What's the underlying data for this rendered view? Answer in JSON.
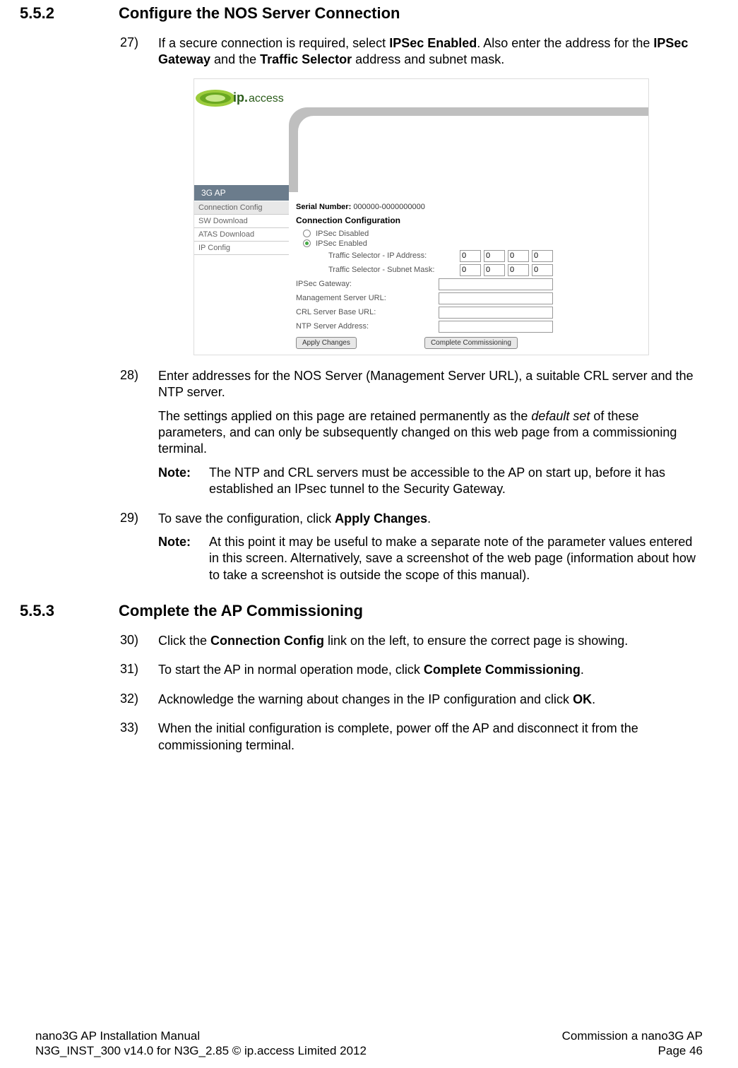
{
  "sections": {
    "s552": {
      "num": "5.5.2",
      "title": "Configure the NOS Server Connection"
    },
    "s553": {
      "num": "5.5.3",
      "title": "Complete the AP Commissioning"
    }
  },
  "steps": {
    "n27": "27)",
    "t27_a": "If a secure connection is required, select ",
    "t27_b": "IPSec Enabled",
    "t27_c": ". Also enter the address for the ",
    "t27_d": "IPSec Gateway",
    "t27_e": " and the ",
    "t27_f": "Traffic Selector",
    "t27_g": " address and subnet mask.",
    "n28": "28)",
    "t28": "Enter addresses for the NOS Server (Management Server URL), a suitable CRL server and the NTP server.",
    "p28a_a": "The settings applied on this page are retained permanently as the ",
    "p28a_b": "default set",
    "p28a_c": " of these parameters, and can only be subsequently changed on this web page from a commissioning terminal.",
    "note1_label": "Note:",
    "note1": "The NTP and CRL servers must be accessible to the AP on start up, before it has established an IPsec tunnel to the Security Gateway.",
    "n29": "29)",
    "t29_a": "To save the configuration, click ",
    "t29_b": "Apply Changes",
    "t29_c": ".",
    "note2_label": "Note:",
    "note2": "At this point it may be useful to make a separate note of the parameter values entered in this screen. Alternatively, save a screenshot of the web page (information about how to take a screenshot is outside the scope of this manual).",
    "n30": "30)",
    "t30_a": "Click the ",
    "t30_b": "Connection Config",
    "t30_c": " link on the left, to ensure the correct page is showing.",
    "n31": "31)",
    "t31_a": "To start the AP in normal operation mode, click ",
    "t31_b": "Complete Commissioning",
    "t31_c": ".",
    "n32": "32)",
    "t32_a": "Acknowledge the warning about changes in the IP configuration and click ",
    "t32_b": "OK",
    "t32_c": ".",
    "n33": "33)",
    "t33": "When the initial configuration is complete, power off the AP and disconnect it from the commissioning terminal."
  },
  "ui": {
    "logo_ip": "ip.",
    "logo_access": "access",
    "tab": "3G AP",
    "sidebar": [
      "Connection Config",
      "SW Download",
      "ATAS Download",
      "IP Config"
    ],
    "serial_label": "Serial Number:",
    "serial_value": "000000-0000000000",
    "config_header": "Connection Configuration",
    "radio_disabled": "IPSec Disabled",
    "radio_enabled": "IPSec Enabled",
    "ts_ip_label": "Traffic Selector - IP Address:",
    "ts_mask_label": "Traffic Selector - Subnet Mask:",
    "gateway_label": "IPSec Gateway:",
    "mgmt_url_label": "Management Server URL:",
    "crl_label": "CRL Server Base URL:",
    "ntp_label": "NTP Server Address:",
    "apply_btn": "Apply Changes",
    "complete_btn": "Complete Commissioning",
    "oct": [
      "0",
      "0",
      "0",
      "0"
    ]
  },
  "footer": {
    "left1": "nano3G AP Installation Manual",
    "left2": "N3G_INST_300 v14.0 for N3G_2.85 © ip.access Limited 2012",
    "right1": "Commission a nano3G AP",
    "right2": "Page 46"
  }
}
